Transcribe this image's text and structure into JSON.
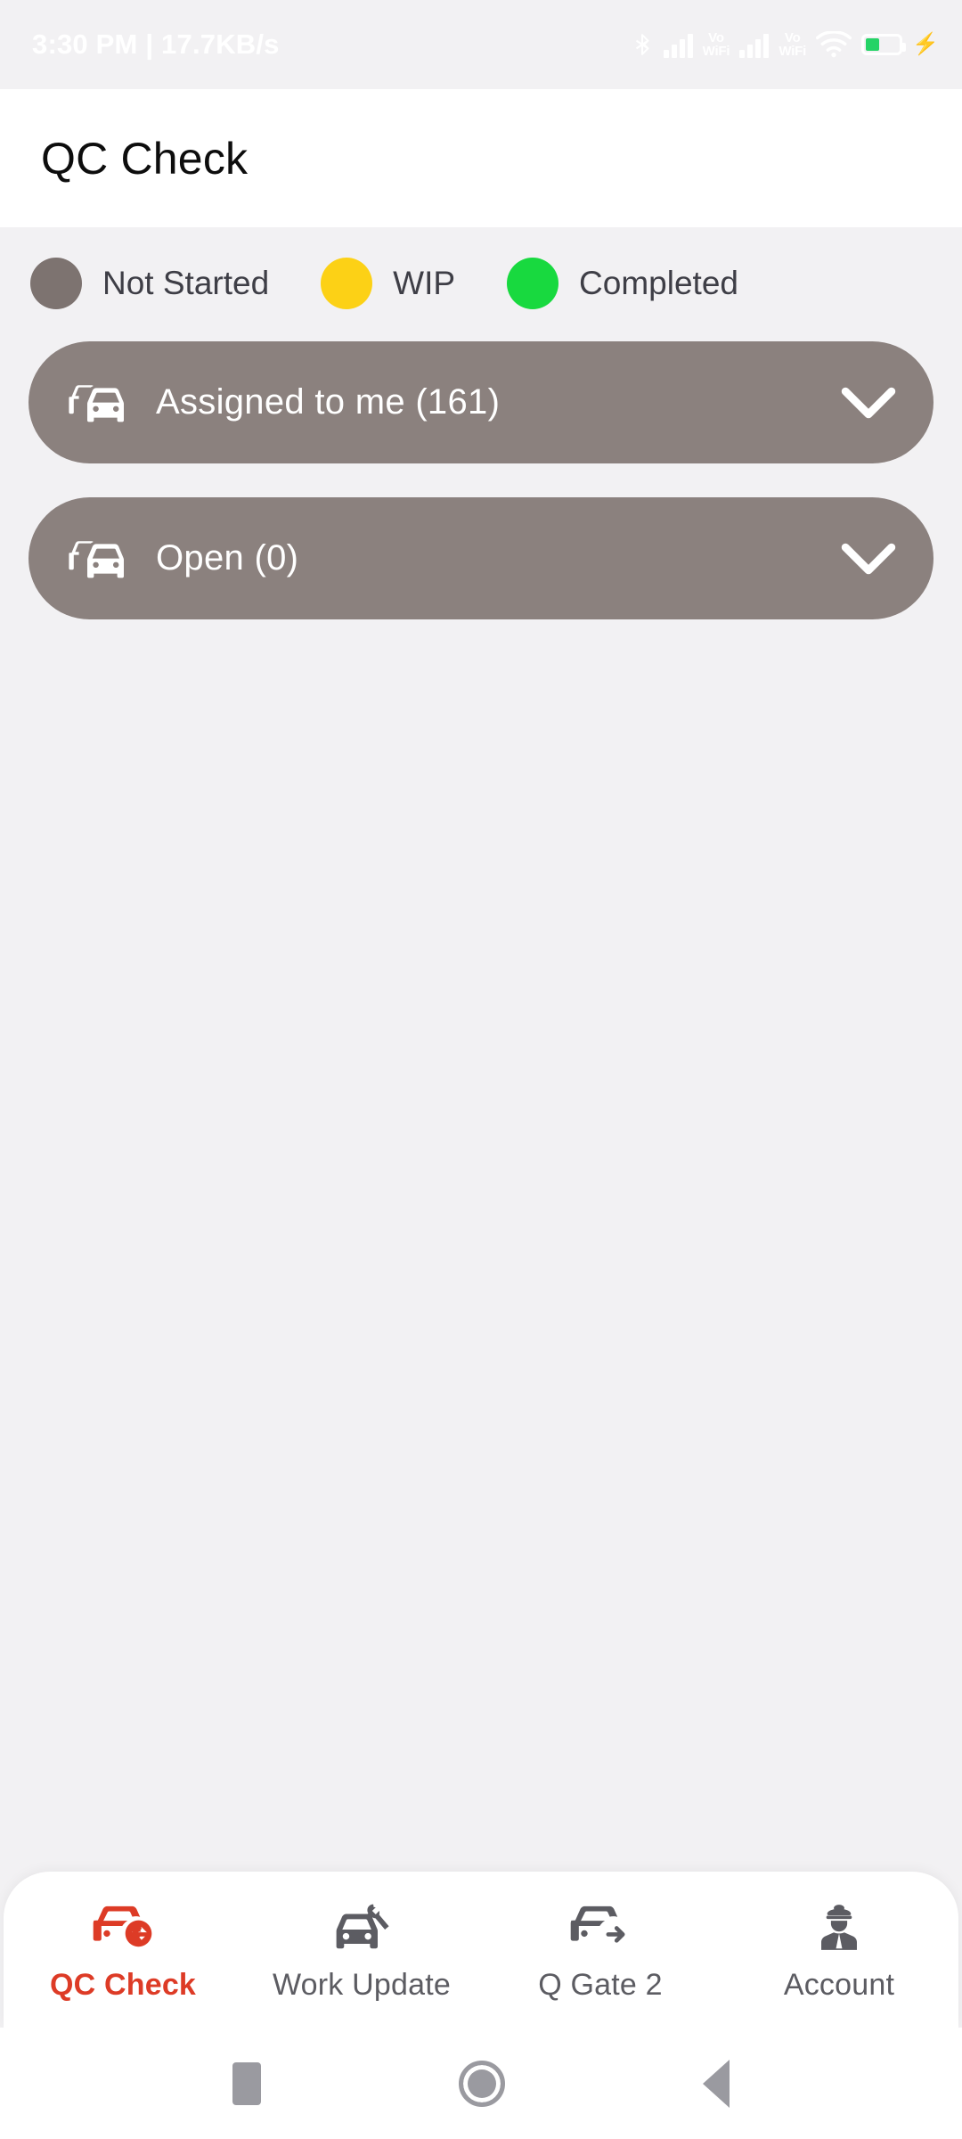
{
  "statusbar": {
    "time_and_speed": "3:30 PM | 17.7KB/s",
    "bluetooth_icon": "bluetooth-icon",
    "signal_icon_1": "signal-bars-icon",
    "vowifi_label_1_line1": "Vo",
    "vowifi_label_1_line2": "WiFi",
    "signal_icon_2": "signal-bars-icon",
    "vowifi_label_2_line1": "Vo",
    "vowifi_label_2_line2": "WiFi",
    "wifi_icon": "wifi-icon",
    "battery_icon": "battery-icon",
    "charging_icon": "charging-bolt-icon"
  },
  "header": {
    "title": "QC Check"
  },
  "legend": {
    "items": [
      {
        "label": "Not Started",
        "color": "#7d7370"
      },
      {
        "label": "WIP",
        "color": "#fcd116"
      },
      {
        "label": "Completed",
        "color": "#18d93f"
      }
    ]
  },
  "cards": [
    {
      "label": "Assigned to me (161)",
      "icon": "cars-fleet-icon",
      "chevron": "chevron-down-icon",
      "color": "#8b817e"
    },
    {
      "label": "Open (0)",
      "icon": "cars-fleet-icon",
      "chevron": "chevron-down-icon",
      "color": "#8b817e"
    }
  ],
  "bottom_nav": {
    "active_color": "#dd3b26",
    "inactive_color": "#5c5c62",
    "items": [
      {
        "label": "QC Check",
        "icon": "car-arrow-left-icon",
        "active": true
      },
      {
        "label": "Work Update",
        "icon": "car-wrench-icon",
        "active": false
      },
      {
        "label": "Q Gate 2",
        "icon": "car-arrow-right-icon",
        "active": false
      },
      {
        "label": "Account",
        "icon": "driver-person-icon",
        "active": false
      }
    ]
  },
  "android_nav": {
    "recents": "recents-square-icon",
    "home": "home-circle-icon",
    "back": "back-triangle-icon"
  }
}
